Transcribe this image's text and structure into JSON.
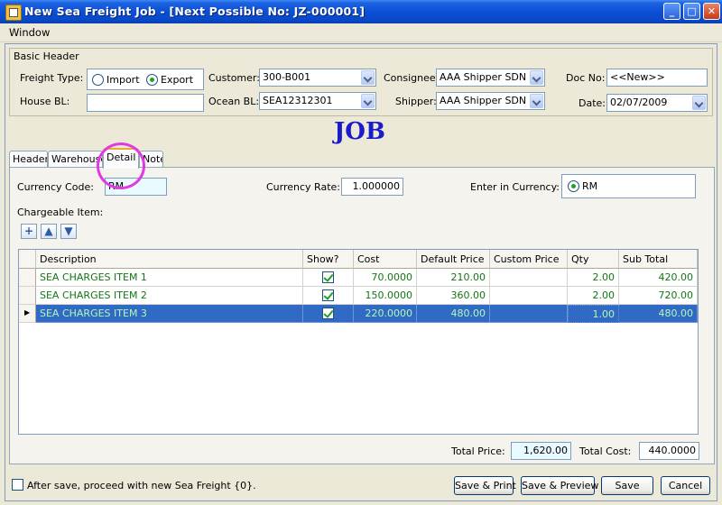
{
  "window": {
    "title": "New Sea Freight Job  - [Next Possible No: JZ-000001]",
    "minimize": "_",
    "maximize": "□",
    "close": "✕"
  },
  "menu": {
    "window": "Window"
  },
  "basic_header": {
    "title": "Basic Header",
    "freight_type_label": "Freight Type:",
    "import_label": "Import",
    "export_label": "Export",
    "freight_type_selected": "Export",
    "house_bl_label": "House BL:",
    "house_bl_value": "",
    "customer_label": "Customer:",
    "customer_value": "300-B001",
    "ocean_bl_label": "Ocean BL:",
    "ocean_bl_value": "SEA12312301",
    "consignee_label": "Consignee:",
    "consignee_value": "AAA Shipper SDN BH",
    "shipper_label": "Shipper:",
    "shipper_value": "AAA Shipper SDN BH",
    "doc_no_label": "Doc No:",
    "doc_no_value": "<<New>>",
    "date_label": "Date:",
    "date_value": "02/07/2009"
  },
  "heading": "JOB",
  "tabs": [
    "Header",
    "Warehouse",
    "Detail",
    "Note"
  ],
  "active_tab": "Detail",
  "detail": {
    "currency_code_label": "Currency Code:",
    "currency_code_value": "RM",
    "currency_rate_label": "Currency Rate:",
    "currency_rate_value": "1.000000",
    "enter_in_currency_label": "Enter in Currency:",
    "enter_in_currency_value": "RM",
    "chargeable_item_label": "Chargeable Item:",
    "toolbar": {
      "add_icon": "plus-icon",
      "up_icon": "move-up-icon",
      "down_icon": "move-down-icon"
    },
    "columns": [
      "Description",
      "Show?",
      "Cost",
      "Default Price",
      "Custom Price",
      "Qty",
      "Sub Total"
    ],
    "rows": [
      {
        "description": "SEA CHARGES ITEM 1",
        "show": true,
        "cost": "70.0000",
        "default_price": "210.00",
        "custom_price": "",
        "qty": "2.00",
        "sub_total": "420.00"
      },
      {
        "description": "SEA CHARGES ITEM 2",
        "show": true,
        "cost": "150.0000",
        "default_price": "360.00",
        "custom_price": "",
        "qty": "2.00",
        "sub_total": "720.00"
      },
      {
        "description": "SEA CHARGES ITEM 3",
        "show": true,
        "cost": "220.0000",
        "default_price": "480.00",
        "custom_price": "",
        "qty": "1.00",
        "sub_total": "480.00"
      }
    ],
    "selected_row": 3,
    "total_price_label": "Total Price:",
    "total_price_value": "1,620.00",
    "total_cost_label": "Total Cost:",
    "total_cost_value": "440.0000"
  },
  "footer": {
    "proceed_label": "After save, proceed with new Sea Freight {0}.",
    "save_print": "Save & Print",
    "save_preview": "Save & Preview",
    "save": "Save",
    "cancel": "Cancel"
  },
  "colors": {
    "title_bar": "#0A4FD6",
    "selected_row": "#316AC5",
    "annotation_circle": "#E13AE0",
    "job_heading": "#1B1BCC"
  }
}
